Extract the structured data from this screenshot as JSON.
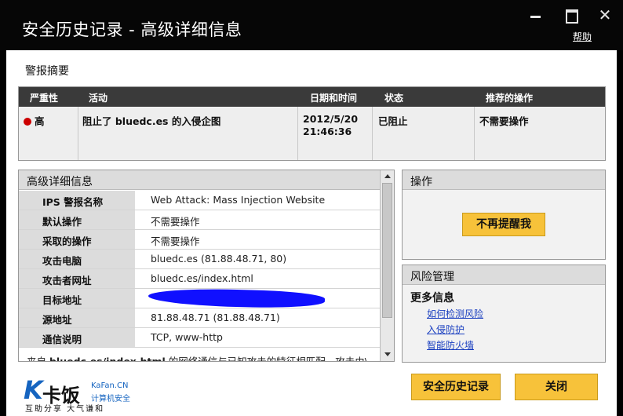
{
  "window": {
    "title": "安全历史记录 - 高级详细信息",
    "help": "帮助",
    "close_glyph": "✕"
  },
  "summary": {
    "title": "警报摘要",
    "headers": {
      "severity": "严重性",
      "activity": "活动",
      "datetime": "日期和时间",
      "status": "状态",
      "recommended": "推荐的操作"
    },
    "row": {
      "severity": "高",
      "activity": "阻止了 bluedc.es 的入侵企图",
      "date": "2012/5/20",
      "time": "21:46:36",
      "status": "已阻止",
      "recommended": "不需要操作"
    },
    "severity_color": "#cc0000"
  },
  "details": {
    "title": "高级详细信息",
    "rows": [
      {
        "label": "IPS 警报名称",
        "value": "Web Attack: Mass Injection Website"
      },
      {
        "label": "默认操作",
        "value": "不需要操作"
      },
      {
        "label": "采取的操作",
        "value": "不需要操作"
      },
      {
        "label": "攻击电脑",
        "value": "bluedc.es (81.88.48.71, 80)"
      },
      {
        "label": "攻击者网址",
        "value": "bluedc.es/index.html"
      },
      {
        "label": "目标地址",
        "value": ""
      },
      {
        "label": "源地址",
        "value": "81.88.48.71 (81.88.48.71)"
      },
      {
        "label": "通信说明",
        "value": "TCP, www-http"
      }
    ],
    "desc_prefix": "来自 ",
    "desc_link": "bluedc.es/index.html",
    "desc_suffix": " 的网络通信与已知攻击的特征相匹配。攻击由\\"
  },
  "operations": {
    "title": "操作",
    "remind_button": "不再提醒我"
  },
  "risk": {
    "title": "风险管理",
    "more_info": "更多信息",
    "links": [
      "如何检测风险",
      "入侵防护",
      "智能防火墙"
    ]
  },
  "logo": {
    "mark": "K",
    "name": "卡饭",
    "url": "KaFan.CN",
    "tagline": "计算机安全",
    "slogan": "互助分享 大气谦和"
  },
  "footer": {
    "history_button": "安全历史记录",
    "close_button": "关闭"
  },
  "colors": {
    "accent_yellow": "#f7c23a",
    "link_blue": "#1a3fc0",
    "title_bar": "#060606"
  }
}
